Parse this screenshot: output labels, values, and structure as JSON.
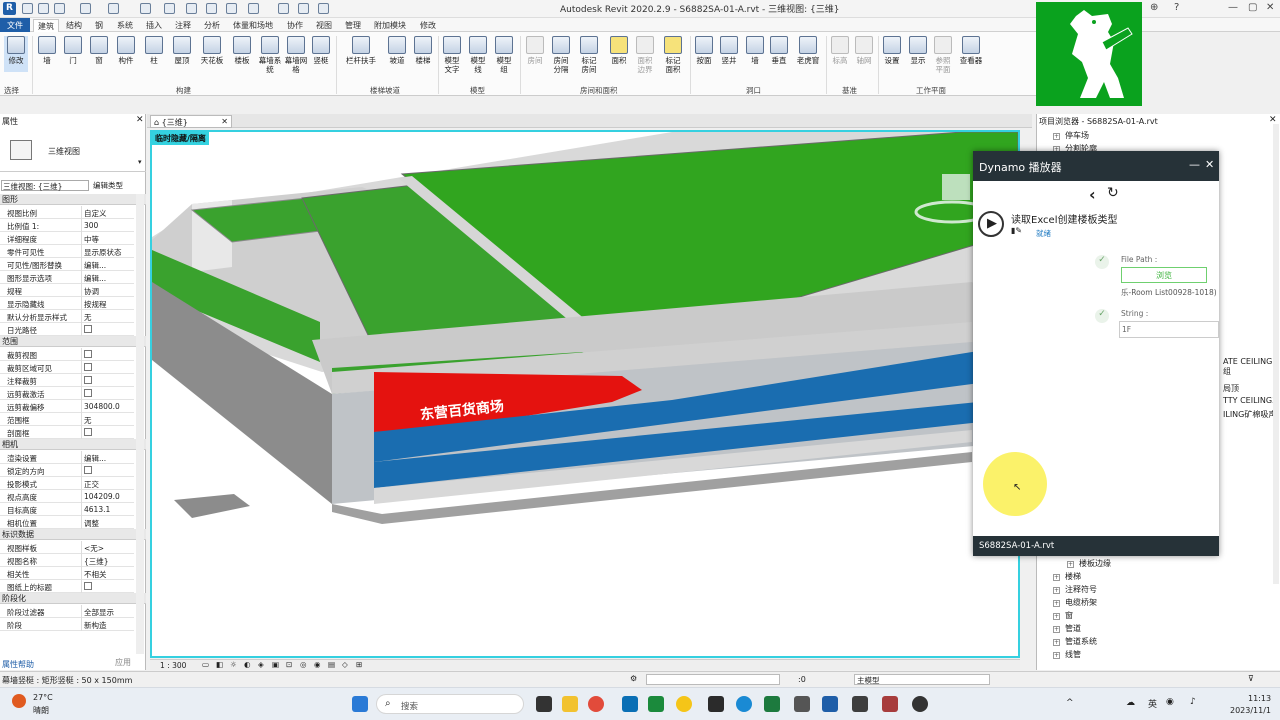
{
  "app": {
    "title": "Autodesk Revit 2020.2.9 - S6882SA-01-A.rvt - 三维视图: {三维}",
    "logo_letter": "R"
  },
  "tabs": [
    "文件",
    "建筑",
    "结构",
    "钢",
    "系统",
    "插入",
    "注释",
    "分析",
    "体量和场地",
    "协作",
    "视图",
    "管理",
    "附加模块",
    "修改"
  ],
  "ribbon": {
    "modify": "修改",
    "select": "选择",
    "build_buttons": [
      "墙",
      "门",
      "窗",
      "构件",
      "柱",
      "屋顶",
      "天花板",
      "楼板",
      "幕墙系统",
      "幕墙网格",
      "竖梃"
    ],
    "build_label": "构建",
    "circulation_buttons": [
      "栏杆扶手",
      "坡道",
      "楼梯"
    ],
    "circulation_label": "楼梯坡道",
    "model_buttons": [
      "模型文字",
      "模型线",
      "模型组"
    ],
    "model_label": "模型",
    "room_buttons": [
      "房间",
      "房间分隔",
      "标记房间",
      "面积",
      "面积边界",
      "标记面积"
    ],
    "room_label": "房间和面积",
    "opening_buttons": [
      "按面",
      "竖井",
      "墙",
      "垂直",
      "老虎窗"
    ],
    "opening_label": "洞口",
    "datum_buttons": [
      "标高",
      "轴网"
    ],
    "datum_label": "基准",
    "workplane_buttons": [
      "设置",
      "显示",
      "参照平面",
      "查看器"
    ],
    "workplane_label": "工作平面"
  },
  "properties": {
    "header": "属性",
    "type_name": "三维视图",
    "view_selector": "三维视图: {三维}",
    "edit_type": "编辑类型",
    "sections": [
      {
        "name": "图形",
        "rows": [
          {
            "k": "视图比例",
            "v": "自定义"
          },
          {
            "k": "比例值 1:",
            "v": "300"
          },
          {
            "k": "详细程度",
            "v": "中等"
          },
          {
            "k": "零件可见性",
            "v": "显示原状态"
          },
          {
            "k": "可见性/图形替换",
            "v": "编辑..."
          },
          {
            "k": "图形显示选项",
            "v": "编辑..."
          },
          {
            "k": "规程",
            "v": "协调"
          },
          {
            "k": "显示隐藏线",
            "v": "按规程"
          },
          {
            "k": "默认分析显示样式",
            "v": "无"
          },
          {
            "k": "日光路径",
            "v": ""
          }
        ]
      },
      {
        "name": "范围",
        "rows": [
          {
            "k": "裁剪视图",
            "v": ""
          },
          {
            "k": "裁剪区域可见",
            "v": ""
          },
          {
            "k": "注释裁剪",
            "v": ""
          },
          {
            "k": "远剪裁激活",
            "v": ""
          },
          {
            "k": "远剪裁偏移",
            "v": "304800.0"
          },
          {
            "k": "范围框",
            "v": "无"
          },
          {
            "k": "剖面框",
            "v": ""
          }
        ]
      },
      {
        "name": "相机",
        "rows": [
          {
            "k": "渲染设置",
            "v": "编辑..."
          },
          {
            "k": "锁定的方向",
            "v": ""
          },
          {
            "k": "投影模式",
            "v": "正交"
          },
          {
            "k": "视点高度",
            "v": "104209.0"
          },
          {
            "k": "目标高度",
            "v": "4613.1"
          },
          {
            "k": "相机位置",
            "v": "调整"
          }
        ]
      },
      {
        "name": "标识数据",
        "rows": [
          {
            "k": "视图样板",
            "v": "<无>"
          },
          {
            "k": "视图名称",
            "v": "{三维}"
          },
          {
            "k": "相关性",
            "v": "不相关"
          },
          {
            "k": "图纸上的标题",
            "v": ""
          }
        ]
      },
      {
        "name": "阶段化",
        "rows": [
          {
            "k": "阶段过滤器",
            "v": "全部显示"
          },
          {
            "k": "阶段",
            "v": "新构造"
          }
        ]
      }
    ],
    "help_link": "属性帮助",
    "apply": "应用"
  },
  "view": {
    "tab_name": "{三维}",
    "temp_badge": "临时隐藏/隔离",
    "scale": "1 : 300",
    "facade_text": "东营百货商场"
  },
  "browser": {
    "title": "项目浏览器 - S6882SA-01-A.rvt",
    "items_top": [
      "停车场",
      "分割轮廓"
    ],
    "items_partial": [
      "ATE CEILING组",
      "局顶",
      "TTY CEILING3",
      "ILING矿棉吸声"
    ],
    "items_bottom": [
      "楼板边缘",
      "楼梯",
      "注释符号",
      "电缆桥架",
      "窗",
      "管道",
      "管道系统",
      "线管"
    ]
  },
  "dynamo": {
    "title": "Dynamo 播放器",
    "script_name": "读取Excel创建楼板类型",
    "status": "就绪",
    "file_path_label": "File Path :",
    "browse": "浏览",
    "file_value": "乐-Room List00928-1018)",
    "string_label": "String :",
    "string_value": "1F",
    "footer": "S6882SA-01-A.rvt"
  },
  "statusbar": {
    "left": "幕墙竖梃 : 矩形竖梃 : 50 x 150mm",
    "zero": ":0",
    "model": "主模型"
  },
  "taskbar": {
    "temp": "27°C",
    "weather": "晴朗",
    "search": "搜索",
    "lang": "英",
    "time": "11:13",
    "date": "2023/11/1"
  }
}
